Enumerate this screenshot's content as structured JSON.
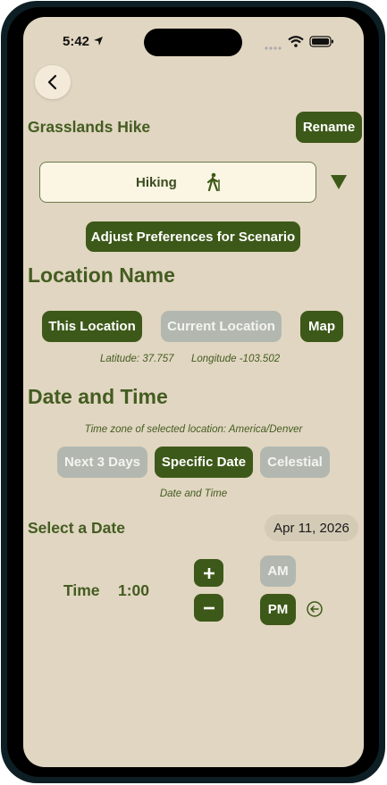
{
  "status": {
    "time": "5:42"
  },
  "header": {
    "title": "Grasslands Hike",
    "rename_label": "Rename"
  },
  "activity": {
    "selected": "Hiking",
    "icon": "hiker-icon"
  },
  "adjust_label": "Adjust Preferences for Scenario",
  "location": {
    "heading": "Location Name",
    "buttons": {
      "this_location": "This Location",
      "current_location": "Current Location",
      "map": "Map"
    },
    "latitude": "Latitude: 37.757",
    "longitude": "Longitude -103.502"
  },
  "datetime": {
    "heading": "Date and Time",
    "timezone": "Time zone of selected location: America/Denver",
    "tabs": {
      "next3": "Next 3 Days",
      "specific": "Specific Date",
      "celestial": "Celestial"
    },
    "caption": "Date and Time",
    "select_label": "Select a Date",
    "date_value": "Apr 11, 2026",
    "time_label": "Time",
    "time_value": "1:00",
    "am": "AM",
    "pm": "PM"
  },
  "colors": {
    "background": "#e1d6c1",
    "accent": "#3d5919",
    "muted": "#b2b8b0",
    "text": "#445c21"
  }
}
